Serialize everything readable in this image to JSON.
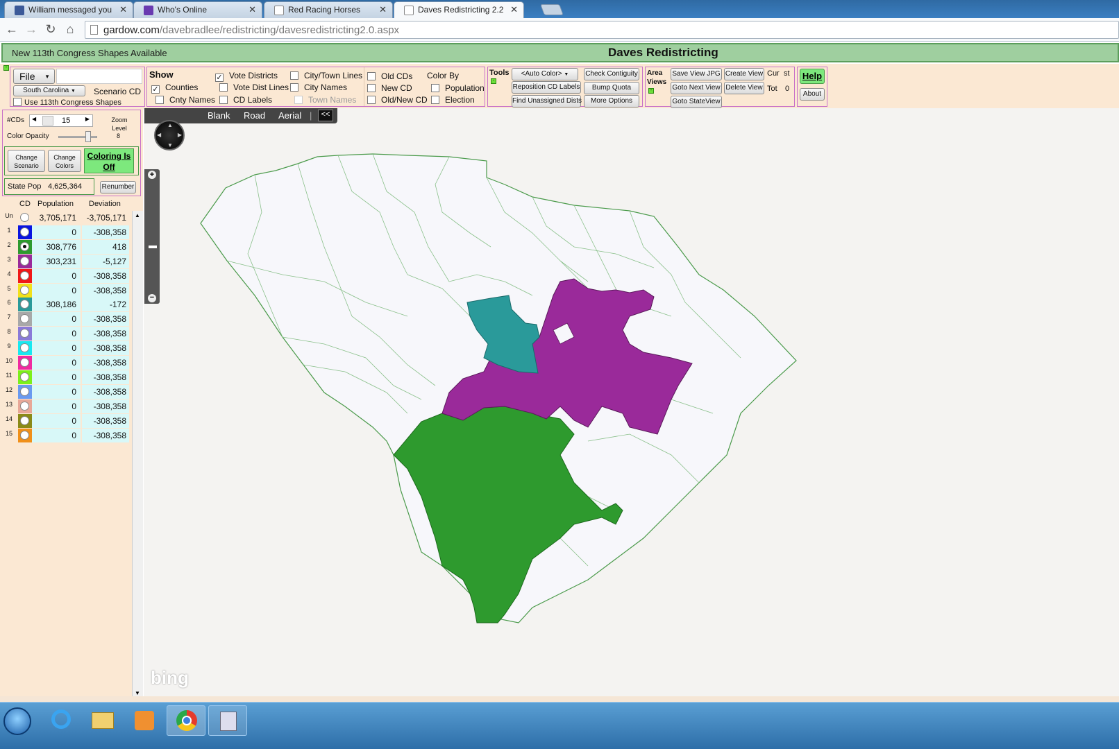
{
  "browser": {
    "tabs": [
      {
        "title": "William messaged you",
        "icon": "facebook-icon"
      },
      {
        "title": "Who's Online",
        "icon": "us-map-favicon"
      },
      {
        "title": "Red Racing Horses",
        "icon": "page-icon"
      },
      {
        "title": "Daves Redistricting 2.2",
        "icon": "page-icon"
      }
    ],
    "url_domain": "gardow.com",
    "url_path": "/davebradlee/redistricting/davesredistricting2.0.aspx"
  },
  "header": {
    "notice": "New 113th Congress Shapes Available",
    "title": "Daves Redistricting"
  },
  "file_panel": {
    "file_label": "File",
    "state": "South Carolina",
    "scenario": "Scenario CD",
    "use113": "Use 113th Congress Shapes"
  },
  "show_panel": {
    "heading": "Show",
    "counties": "Counties",
    "cnty_names": "Cnty Names",
    "vote_districts": "Vote Districts",
    "vote_dist_lines": "Vote Dist Lines",
    "cd_labels": "CD Labels",
    "city_town_lines": "City/Town Lines",
    "city_names": "City Names",
    "town_names": "Town Names",
    "old_cds": "Old CDs",
    "new_cd": "New CD",
    "old_new_cd": "Old/New CD",
    "color_by": "Color By",
    "population": "Population",
    "election": "Election"
  },
  "tools_panel": {
    "heading": "Tools",
    "auto_color": "<Auto Color>",
    "reposition": "Reposition CD Labels",
    "find_unassigned": "Find Unassigned Dists",
    "check_contiguity": "Check Contiguity",
    "bump_quota": "Bump Quota",
    "more_options": "More Options"
  },
  "views_panel": {
    "heading": "Area Views",
    "save_view": "Save View JPG",
    "goto_next": "Goto Next View",
    "goto_state": "Goto StateView",
    "create_view": "Create View",
    "delete_view": "Delete View",
    "cur_label": "Cur",
    "cur_value": "st",
    "tot_label": "Tot",
    "tot_value": "0"
  },
  "help": {
    "help": "Help",
    "about": "About"
  },
  "left": {
    "num_cds_label": "#CDs",
    "num_cds": "15",
    "zoom_label": "Zoom Level",
    "zoom_value": "8",
    "color_opacity": "Color Opacity",
    "change_scenario": "Change Scenario",
    "change_colors": "Change Colors",
    "coloring": "Coloring Is Off",
    "state_pop_label": "State Pop",
    "state_pop": "4,625,364",
    "renumber": "Renumber",
    "col_cd": "CD",
    "col_population": "Population",
    "col_deviation": "Deviation"
  },
  "districts": [
    {
      "cd": "Un",
      "color": "#ffffff",
      "population": "3,705,171",
      "deviation": "-3,705,171"
    },
    {
      "cd": "1",
      "color": "#0a14e0",
      "population": "0",
      "deviation": "-308,358"
    },
    {
      "cd": "2",
      "color": "#2e9a2e",
      "population": "308,776",
      "deviation": "418"
    },
    {
      "cd": "3",
      "color": "#9a2a9a",
      "population": "303,231",
      "deviation": "-5,127"
    },
    {
      "cd": "4",
      "color": "#f01818",
      "population": "0",
      "deviation": "-308,358"
    },
    {
      "cd": "5",
      "color": "#f2e01a",
      "population": "0",
      "deviation": "-308,358"
    },
    {
      "cd": "6",
      "color": "#2a9a9a",
      "population": "308,186",
      "deviation": "-172"
    },
    {
      "cd": "7",
      "color": "#a8a8a8",
      "population": "0",
      "deviation": "-308,358"
    },
    {
      "cd": "8",
      "color": "#8a7ad8",
      "population": "0",
      "deviation": "-308,358"
    },
    {
      "cd": "9",
      "color": "#18e8f0",
      "population": "0",
      "deviation": "-308,358"
    },
    {
      "cd": "10",
      "color": "#f02aa0",
      "population": "0",
      "deviation": "-308,358"
    },
    {
      "cd": "11",
      "color": "#7cf01a",
      "population": "0",
      "deviation": "-308,358"
    },
    {
      "cd": "12",
      "color": "#6a9af0",
      "population": "0",
      "deviation": "-308,358"
    },
    {
      "cd": "13",
      "color": "#e8a898",
      "population": "0",
      "deviation": "-308,358"
    },
    {
      "cd": "14",
      "color": "#8a8a18",
      "population": "0",
      "deviation": "-308,358"
    },
    {
      "cd": "15",
      "color": "#f0901a",
      "population": "0",
      "deviation": "-308,358"
    }
  ],
  "map": {
    "blank": "Blank",
    "road": "Road",
    "aerial": "Aerial",
    "collapse": "<<",
    "attribution": "bing",
    "district_colors": {
      "cd2": "#2e9a2e",
      "cd3": "#9a2a9a",
      "cd6": "#2a9a9a",
      "land": "#f7f7fb",
      "border": "#4a9a4a"
    }
  }
}
